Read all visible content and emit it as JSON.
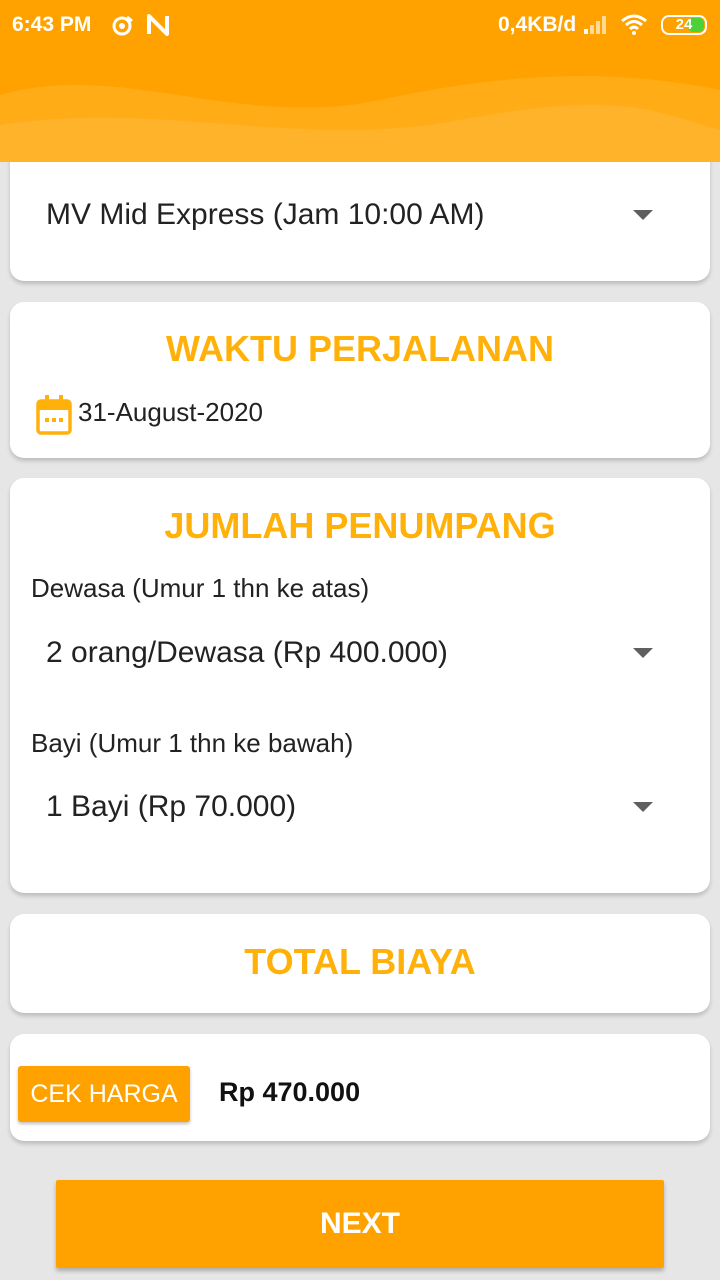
{
  "status_bar": {
    "time": "6:43 PM",
    "network_speed": "0,4KB/d",
    "battery_level": "24"
  },
  "ship": {
    "selected": "MV Mid Express (Jam 10:00 AM)"
  },
  "travel_time": {
    "title": "WAKTU PERJALANAN",
    "date": "31-August-2020"
  },
  "passengers": {
    "title": "JUMLAH PENUMPANG",
    "adult_label": "Dewasa (Umur 1 thn ke atas)",
    "adult_selected": "2 orang/Dewasa (Rp 400.000)",
    "infant_label": "Bayi (Umur 1 thn ke bawah)",
    "infant_selected": "1 Bayi (Rp 70.000)"
  },
  "total": {
    "title": "TOTAL BIAYA",
    "check_button": "CEK HARGA",
    "amount": "Rp 470.000"
  },
  "next_button": "NEXT",
  "colors": {
    "primary": "#ffa200",
    "title_yellow": "#ffb10a"
  },
  "icons": [
    "alarm-icon",
    "n-app-icon",
    "signal-icon",
    "wifi-icon",
    "battery-icon",
    "calendar-icon",
    "dropdown-arrow-icon"
  ]
}
